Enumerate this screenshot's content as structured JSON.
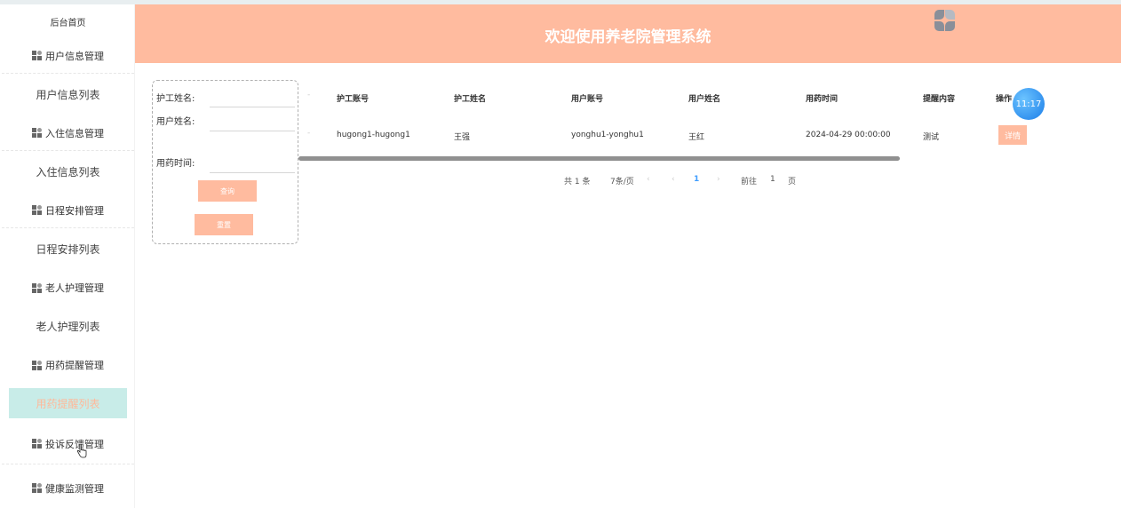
{
  "header": {
    "title": "欢迎使用养老院管理系统"
  },
  "sidebar": {
    "home": "后台首页",
    "menu": [
      {
        "group": "用户信息管理",
        "sub": "用户信息列表"
      },
      {
        "group": "入住信息管理",
        "sub": "入住信息列表"
      },
      {
        "group": "日程安排管理",
        "sub": "日程安排列表"
      },
      {
        "group": "老人护理管理",
        "sub": "老人护理列表"
      },
      {
        "group": "用药提醒管理",
        "sub": "用药提醒列表"
      },
      {
        "group": "投诉反馈管理"
      },
      {
        "group": "健康监测管理"
      }
    ]
  },
  "search": {
    "nurse_name_label": "护工姓名:",
    "user_name_label": "用户姓名:",
    "med_time_label": "用药时间:",
    "query_button": "查询",
    "reset_button": "重置"
  },
  "table": {
    "columns": [
      "护工账号",
      "护工姓名",
      "用户账号",
      "用户姓名",
      "用药时间",
      "提醒内容",
      "操作"
    ],
    "rows": [
      {
        "nurse_account": "hugong1-hugong1",
        "nurse_name": "王强",
        "user_account": "yonghu1-yonghu1",
        "user_name": "王红",
        "med_time": "2024-04-29 00:00:00",
        "content": "测试",
        "action": "详情"
      }
    ]
  },
  "pagination": {
    "total": "共 1 条",
    "page_size": "7条/页",
    "current_page": "1",
    "goto_label": "前往",
    "goto_value": "1",
    "page_unit": "页"
  },
  "clock": {
    "time": "11:17"
  },
  "colors": {
    "accent": "#ffbb9f",
    "active_bg": "#c8ece8",
    "link": "#409eff"
  }
}
